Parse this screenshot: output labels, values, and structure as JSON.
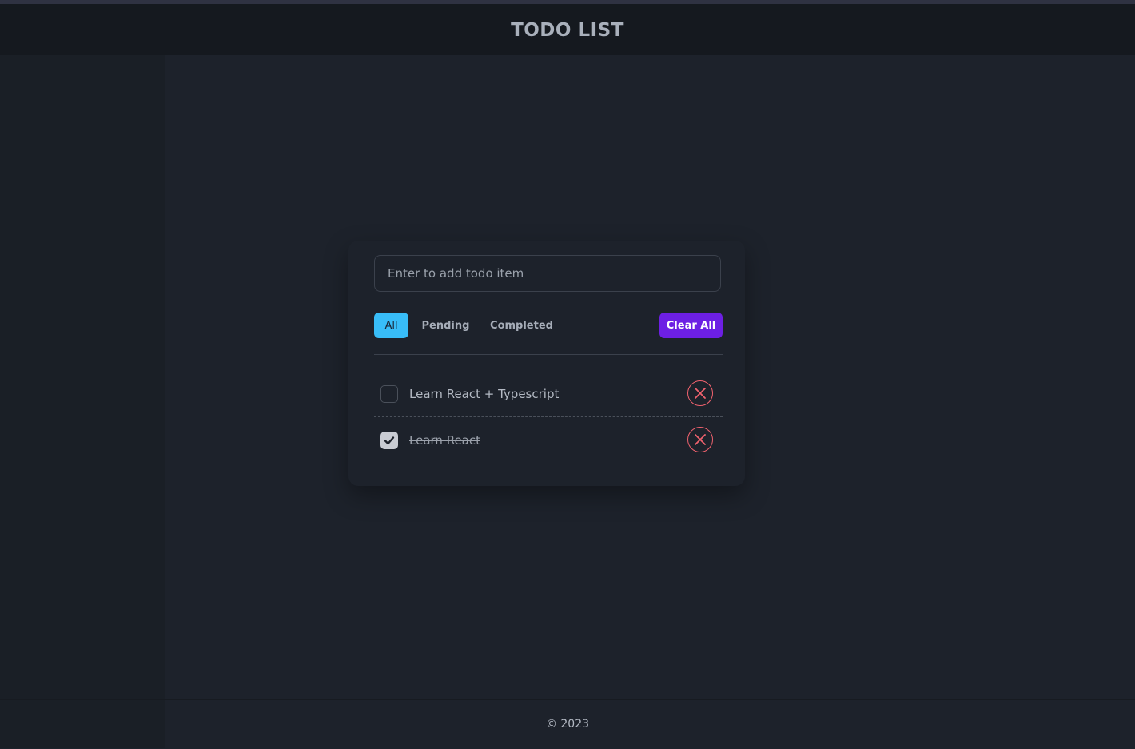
{
  "header": {
    "title": "TODO LIST"
  },
  "input": {
    "placeholder": "Enter to add todo item",
    "value": ""
  },
  "filters": {
    "items": [
      {
        "label": "All",
        "active": true
      },
      {
        "label": "Pending",
        "active": false
      },
      {
        "label": "Completed",
        "active": false
      }
    ],
    "clear_label": "Clear All"
  },
  "todos": [
    {
      "text": "Learn React + Typescript",
      "completed": false
    },
    {
      "text": "Learn React",
      "completed": true
    }
  ],
  "footer": {
    "text": "© 2023"
  },
  "colors": {
    "accent_active_filter": "#38bdf8",
    "clear_button": "#6d1fe4",
    "delete_icon": "#f0626e",
    "background": "#1d222b",
    "header_bg": "#15191f"
  },
  "icons": {
    "checkbox_checked": "check-icon",
    "delete": "close-circle-icon"
  }
}
